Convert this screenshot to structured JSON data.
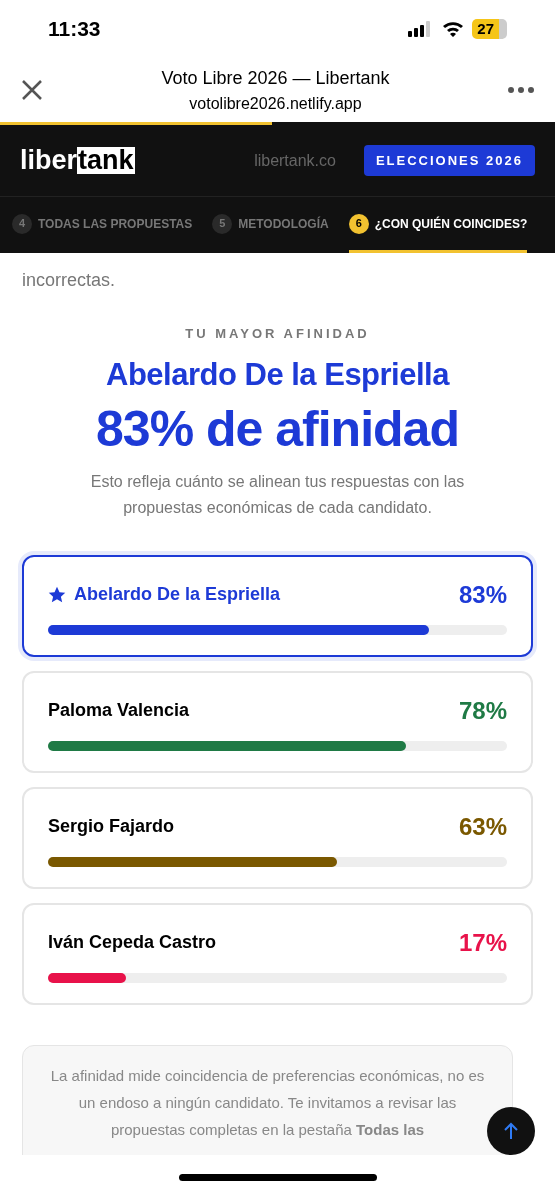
{
  "status_bar": {
    "time": "11:33",
    "battery": "27"
  },
  "browser": {
    "title": "Voto Libre 2026 — Libertank",
    "url": "votolibre2026.netlify.app",
    "load_progress": {
      "level": 0.49
    }
  },
  "header": {
    "logo": {
      "part_1": "liber",
      "part_2": "tank"
    },
    "link": "libertank.co",
    "button": "ELECCIONES 2026"
  },
  "tabs": [
    {
      "number": "4",
      "label": "TODAS LAS PROPUESTAS",
      "selected": false
    },
    {
      "number": "5",
      "label": "METODOLOGÍA",
      "selected": false
    },
    {
      "number": "6",
      "label": "¿CON QUIÉN COINCIDES?",
      "selected": true
    }
  ],
  "intro_tail": "incorrectas.",
  "result": {
    "eyebrow": "TU MAYOR AFINIDAD",
    "name": "Abelardo De la Espriella",
    "score": "83% de afinidad",
    "explanation": "Esto refleja cuánto se alinean tus respuestas con las propuestas económicas de cada candidato."
  },
  "candidates": [
    {
      "name": "Abelardo De la Espriella",
      "percent": "83%",
      "level": 0.83,
      "color": "#1d3ad6",
      "selected": true
    },
    {
      "name": "Paloma Valencia",
      "percent": "78%",
      "level": 0.78,
      "color": "#1f7a45",
      "selected": false
    },
    {
      "name": "Sergio Fajardo",
      "percent": "63%",
      "level": 0.63,
      "color": "#7a5800",
      "selected": false
    },
    {
      "name": "Iván Cepeda Castro",
      "percent": "17%",
      "level": 0.17,
      "color": "#e8124a",
      "selected": false
    }
  ],
  "disclaimer": "La afinidad mide coincidencia de preferencias económicas, no es un endoso a ningún candidato. Te invitamos a revisar las propuestas completas en la pestaña **Todas las**"
}
